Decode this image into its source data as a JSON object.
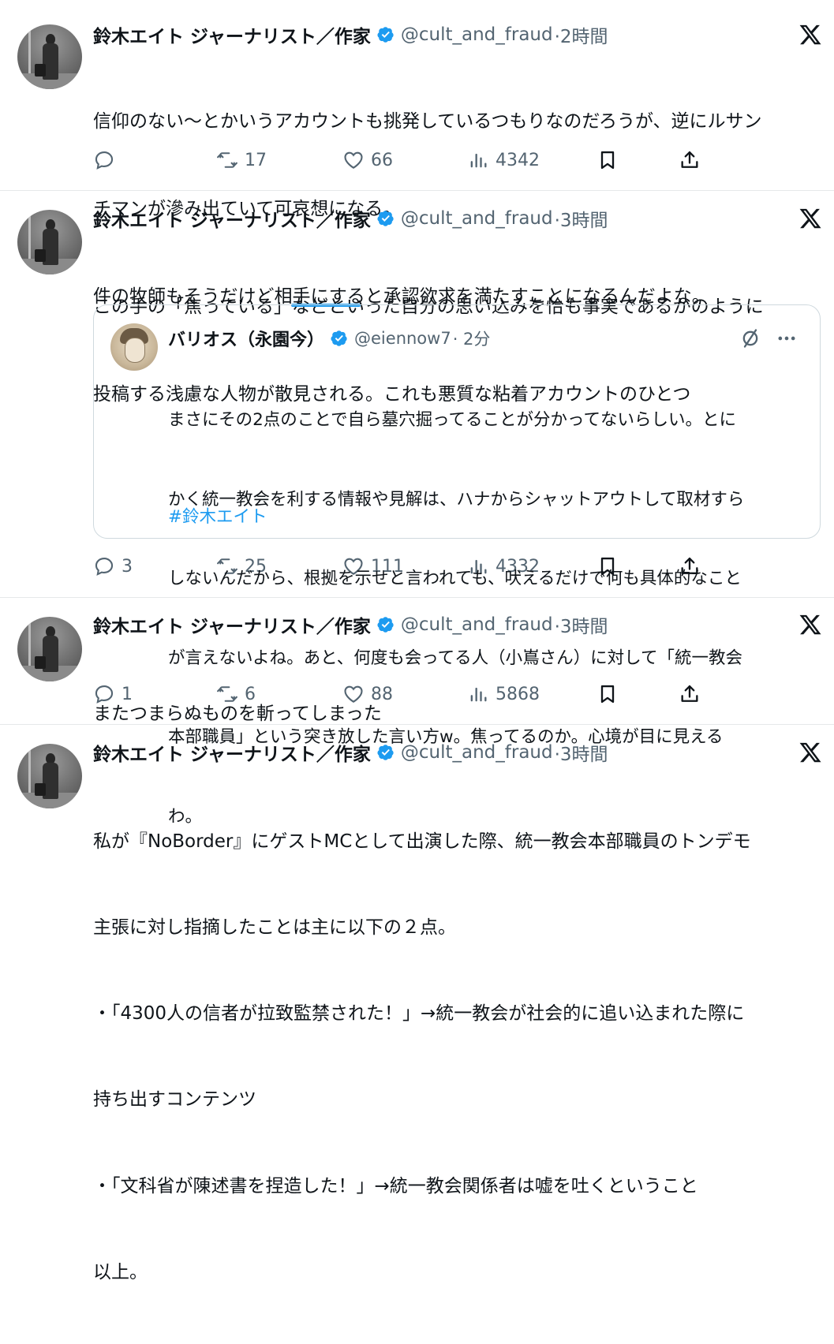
{
  "tweets": [
    {
      "name": "鈴木エイト ジャーナリスト／作家",
      "handle": "@cult_and_fraud",
      "time": "·2時間",
      "lines": [
        "信仰のない〜とかいうアカウントも挑発しているつもりなのだろうが、逆にルサン",
        "チマンが滲み出ていて可哀想になる。",
        "件の牧師もそうだけど相手にすると承認欲求を満たすことになるんだよな。"
      ],
      "replies": "",
      "retweets": "17",
      "likes": "66",
      "views": "4342"
    },
    {
      "name": "鈴木エイト ジャーナリスト／作家",
      "handle": "@cult_and_fraud",
      "time": "·3時間",
      "lines": [
        "この手の「焦っている」などといった自分の思い込みを恰も事実であるかのように",
        "投稿する浅慮な人物が散見される。これも悪質な粘着アカウントのひとつ"
      ],
      "replies": "3",
      "retweets": "25",
      "likes": "111",
      "views": "4332",
      "quote": {
        "name": "バリオス（永園今）",
        "handle": "@eiennow7",
        "time": "· 2分",
        "lines": [
          "まさにその2点のことで自ら墓穴掘ってることが分かってないらしい。とに",
          "かく統一教会を利する情報や見解は、ハナからシャットアウトして取材すら",
          "しないんだから、根拠を示せと言われても、吠えるだけで何も具体的なこと",
          "が言えないよね。あと、何度も会ってる人（小嶌さん）に対して「統一教会",
          "本部職員」という突き放した言い方w。焦ってるのか。心境が目に見える",
          "わ。"
        ],
        "hashtag": "#鈴木エイト"
      }
    },
    {
      "name": "鈴木エイト ジャーナリスト／作家",
      "handle": "@cult_and_fraud",
      "time": "·3時間",
      "lines": [
        "またつまらぬものを斬ってしまった"
      ],
      "replies": "1",
      "retweets": "6",
      "likes": "88",
      "views": "5868"
    },
    {
      "name": "鈴木エイト ジャーナリスト／作家",
      "handle": "@cult_and_fraud",
      "time": "·3時間",
      "lines": [
        "私が『NoBorder』にゲストMCとして出演した際、統一教会本部職員のトンデモ",
        "主張に対し指摘したことは主に以下の２点。",
        "・「4300人の信者が拉致監禁された！」→統一教会が社会的に追い込まれた際に",
        "持ち出すコンテンツ",
        "・「文科省が陳述書を捏造した！」→統一教会関係者は嘘を吐くということ",
        "以上。"
      ]
    }
  ],
  "colors": {
    "accent": "#1d9bf0",
    "muted": "#536471",
    "text": "#0f1419",
    "border": "#cfd9de"
  },
  "icons": [
    "verified-badge-icon",
    "x-logo-icon",
    "reply-icon",
    "retweet-icon",
    "like-icon",
    "views-icon",
    "bookmark-icon",
    "share-icon",
    "translate-icon",
    "more-icon"
  ]
}
